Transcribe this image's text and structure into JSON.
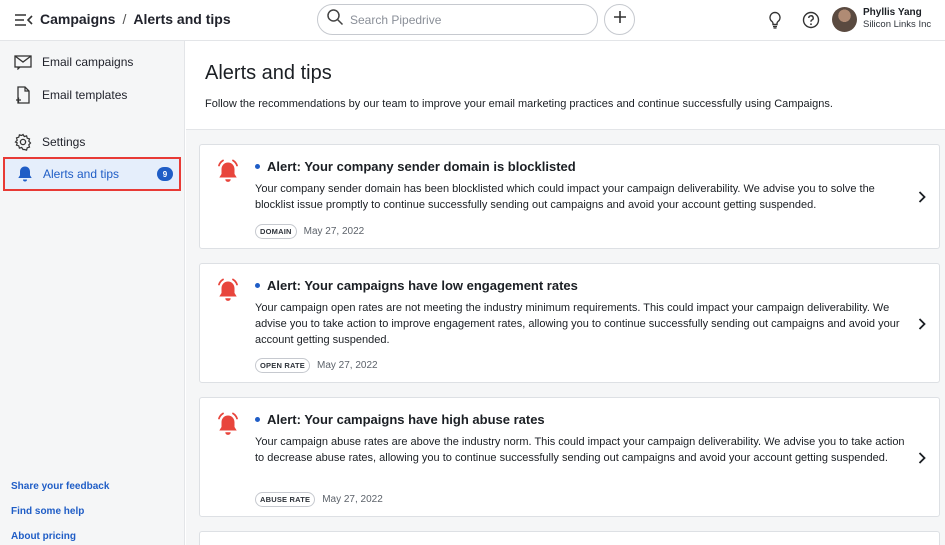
{
  "header": {
    "breadcrumb_root": "Campaigns",
    "breadcrumb_sep": "/",
    "breadcrumb_current": "Alerts and tips",
    "search_placeholder": "Search Pipedrive",
    "user_name": "Phyllis Yang",
    "user_org": "Silicon Links Inc"
  },
  "sidebar": {
    "items": [
      {
        "label": "Email campaigns",
        "icon": "email-campaign-icon"
      },
      {
        "label": "Email templates",
        "icon": "email-template-icon"
      },
      {
        "label": "Settings",
        "icon": "gear-icon"
      },
      {
        "label": "Alerts and tips",
        "icon": "bell-icon",
        "badge": "9",
        "active": true
      }
    ],
    "footer_links": [
      "Share your feedback",
      "Find some help",
      "About pricing"
    ]
  },
  "main": {
    "title": "Alerts and tips",
    "description": "Follow the recommendations by our team to improve your email marketing practices and continue successfully using Campaigns.",
    "alerts": [
      {
        "title": "Alert: Your company sender domain is blocklisted",
        "body": "Your company sender domain has been blocklisted which could impact your campaign deliverability. We advise you to solve the blocklist issue promptly to continue successfully sending out campaigns and avoid your account getting suspended.",
        "tag": "DOMAIN",
        "date": "May 27, 2022"
      },
      {
        "title": "Alert: Your campaigns have low engagement rates",
        "body": "Your campaign open rates are not meeting the industry minimum requirements. This could impact your campaign deliverability. We advise you to take action to improve engagement rates, allowing you to continue successfully sending out campaigns and avoid your account getting suspended.",
        "tag": "OPEN RATE",
        "date": "May 27, 2022"
      },
      {
        "title": "Alert: Your campaigns have high abuse rates",
        "body": "Your campaign abuse rates are above the industry norm. This could impact your campaign deliverability. We advise you to take action to decrease abuse rates, allowing you to continue successfully sending out campaigns and avoid your account getting suspended.",
        "tag": "ABUSE RATE",
        "date": "May 27, 2022"
      }
    ]
  },
  "colors": {
    "accent": "#1f5dc6",
    "alert_red": "#e8453c",
    "highlight_border": "#e83a35"
  }
}
